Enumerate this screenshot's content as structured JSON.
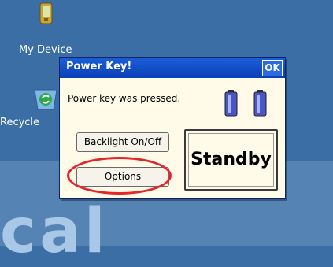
{
  "desktop": {
    "icons": [
      {
        "label": "My Device"
      },
      {
        "label": "Recycle"
      }
    ],
    "watermark": "cal"
  },
  "dialog": {
    "title": "Power Key!",
    "ok_label": "OK",
    "message": "Power key was pressed.",
    "buttons": {
      "backlight": "Backlight On/Off",
      "options": "Options",
      "standby": "Standby"
    }
  },
  "colors": {
    "desktop": "#3a6ea5",
    "titlebar": "#0a3fb8",
    "dialog_bg": "#fffbe8",
    "highlight": "#e8242b"
  }
}
